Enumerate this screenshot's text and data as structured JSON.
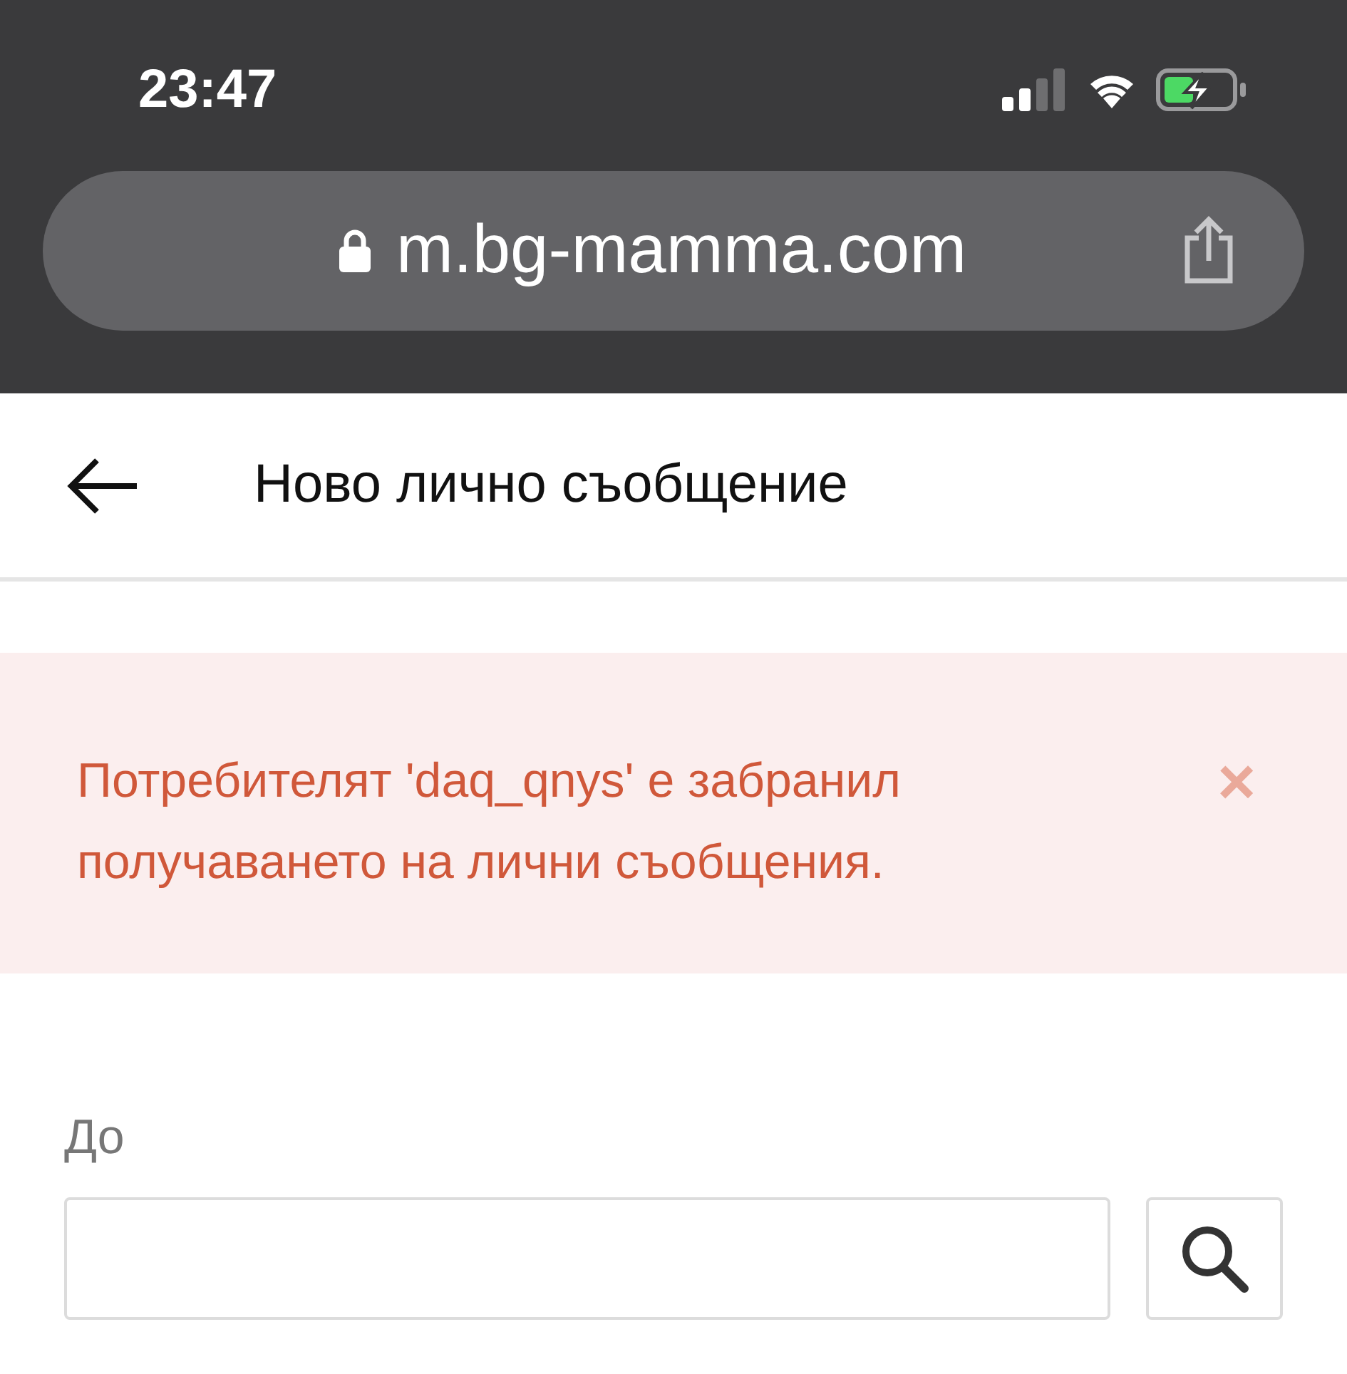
{
  "status_bar": {
    "time": "23:47"
  },
  "browser": {
    "url": "m.bg-mamma.com"
  },
  "header": {
    "title": "Ново лично съобщение"
  },
  "alert": {
    "message": "Потребителят 'daq_qnys' е забранил получаването на лични съобщения.",
    "close": "×"
  },
  "form": {
    "to_label": "До"
  }
}
